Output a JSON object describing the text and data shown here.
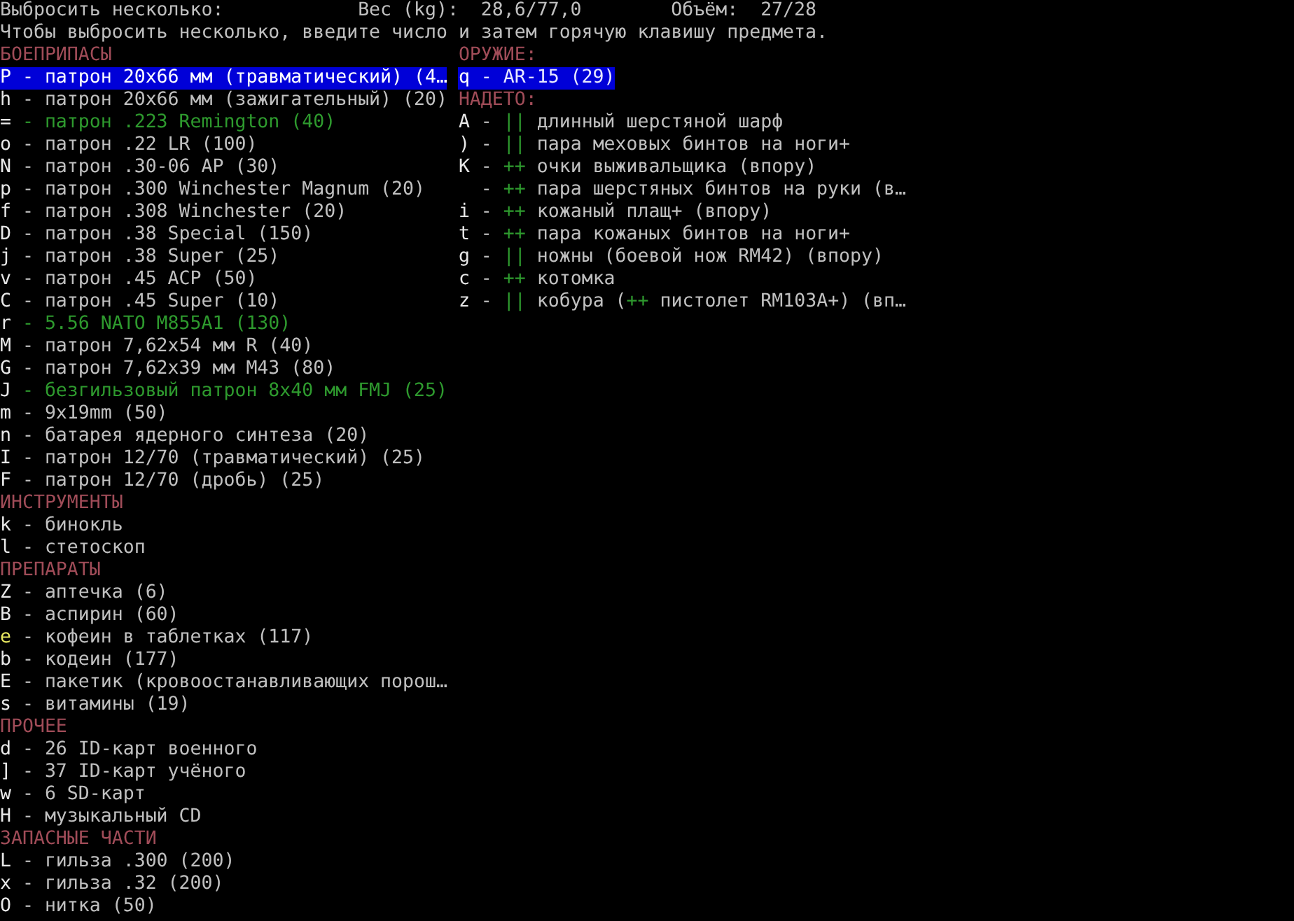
{
  "header": {
    "title": "Выбросить несколько:",
    "weight_label": "Вес (kg):",
    "weight_value": "28,6/77,0",
    "volume_label": "Объём:",
    "volume_value": "27/28"
  },
  "instructions": "Чтобы выбросить несколько, введите число и затем горячую клавишу предмета.",
  "left_sections": [
    {
      "title": "БОЕПРИПАСЫ",
      "items": [
        {
          "key": "P",
          "label": "- патрон 20x66 мм (травматический) (4…",
          "kind": "plain",
          "key_highlighted": false,
          "selected": true
        },
        {
          "key": "h",
          "label": "- патрон 20x66 мм (зажигательный) (20)",
          "kind": "plain",
          "key_highlighted": false,
          "selected": false
        },
        {
          "key": "=",
          "label": "- патрон .223 Remington (40)",
          "kind": "marked",
          "key_highlighted": false,
          "selected": false
        },
        {
          "key": "o",
          "label": "- патрон .22 LR (100)",
          "kind": "plain",
          "key_highlighted": false,
          "selected": false
        },
        {
          "key": "N",
          "label": "- патрон .30-06 AP (30)",
          "kind": "plain",
          "key_highlighted": false,
          "selected": false
        },
        {
          "key": "p",
          "label": "- патрон .300 Winchester Magnum (20)",
          "kind": "plain",
          "key_highlighted": false,
          "selected": false
        },
        {
          "key": "f",
          "label": "- патрон .308 Winchester (20)",
          "kind": "plain",
          "key_highlighted": false,
          "selected": false
        },
        {
          "key": "D",
          "label": "- патрон .38 Special (150)",
          "kind": "plain",
          "key_highlighted": false,
          "selected": false
        },
        {
          "key": "j",
          "label": "- патрон .38 Super (25)",
          "kind": "plain",
          "key_highlighted": false,
          "selected": false
        },
        {
          "key": "v",
          "label": "- патрон .45 ACP (50)",
          "kind": "plain",
          "key_highlighted": false,
          "selected": false
        },
        {
          "key": "C",
          "label": "- патрон .45 Super (10)",
          "kind": "plain",
          "key_highlighted": false,
          "selected": false
        },
        {
          "key": "r",
          "label": "- 5.56 NATO M855A1 (130)",
          "kind": "marked",
          "key_highlighted": false,
          "selected": false
        },
        {
          "key": "M",
          "label": "- патрон 7,62x54 мм R (40)",
          "kind": "plain",
          "key_highlighted": false,
          "selected": false
        },
        {
          "key": "G",
          "label": "- патрон 7,62x39 мм M43 (80)",
          "kind": "plain",
          "key_highlighted": false,
          "selected": false
        },
        {
          "key": "J",
          "label": "- безгильзовый патрон 8x40 мм FMJ (25)",
          "kind": "marked",
          "key_highlighted": false,
          "selected": false
        },
        {
          "key": "m",
          "label": "- 9x19mm (50)",
          "kind": "plain",
          "key_highlighted": false,
          "selected": false
        },
        {
          "key": "n",
          "label": "- батарея ядерного синтеза (20)",
          "kind": "plain",
          "key_highlighted": false,
          "selected": false
        },
        {
          "key": "I",
          "label": "- патрон 12/70 (травматический) (25)",
          "kind": "plain",
          "key_highlighted": false,
          "selected": false
        },
        {
          "key": "F",
          "label": "- патрон 12/70 (дробь) (25)",
          "kind": "plain",
          "key_highlighted": false,
          "selected": false
        }
      ]
    },
    {
      "title": "ИНСТРУМЕНТЫ",
      "items": [
        {
          "key": "k",
          "label": "- бинокль",
          "kind": "plain",
          "key_highlighted": false,
          "selected": false
        },
        {
          "key": "l",
          "label": "- стетоскоп",
          "kind": "plain",
          "key_highlighted": false,
          "selected": false
        }
      ]
    },
    {
      "title": "ПРЕПАРАТЫ",
      "items": [
        {
          "key": "Z",
          "label": "- аптечка (6)",
          "kind": "plain",
          "key_highlighted": false,
          "selected": false
        },
        {
          "key": "B",
          "label": "- аспирин (60)",
          "kind": "plain",
          "key_highlighted": false,
          "selected": false
        },
        {
          "key": "e",
          "label": "- кофеин в таблетках (117)",
          "kind": "plain",
          "key_highlighted": true,
          "selected": false
        },
        {
          "key": "b",
          "label": "- кодеин (177)",
          "kind": "plain",
          "key_highlighted": false,
          "selected": false
        },
        {
          "key": "E",
          "label": "- пакетик (кровоостанавливающих порош…",
          "kind": "plain",
          "key_highlighted": false,
          "selected": false
        },
        {
          "key": "s",
          "label": "- витамины (19)",
          "kind": "plain",
          "key_highlighted": false,
          "selected": false
        }
      ]
    },
    {
      "title": "ПРОЧЕЕ",
      "items": [
        {
          "key": "d",
          "label": "- 26 ID-карт военного",
          "kind": "plain",
          "key_highlighted": false,
          "selected": false
        },
        {
          "key": "]",
          "label": "- 37 ID-карт учёного",
          "kind": "plain",
          "key_highlighted": false,
          "selected": false
        },
        {
          "key": "w",
          "label": "- 6 SD-карт",
          "kind": "plain",
          "key_highlighted": false,
          "selected": false
        },
        {
          "key": "H",
          "label": "- музыкальный CD",
          "kind": "plain",
          "key_highlighted": false,
          "selected": false
        }
      ]
    },
    {
      "title": "ЗАПАСНЫЕ ЧАСТИ",
      "items": [
        {
          "key": "L",
          "label": "- гильза .300 (200)",
          "kind": "plain",
          "key_highlighted": false,
          "selected": false
        },
        {
          "key": "x",
          "label": "- гильза .32 (200)",
          "kind": "plain",
          "key_highlighted": false,
          "selected": false
        },
        {
          "key": "O",
          "label": "- нитка (50)",
          "kind": "plain",
          "key_highlighted": false,
          "selected": false
        }
      ]
    }
  ],
  "weapon": {
    "title": "ОРУЖИЕ:",
    "items": [
      {
        "key": "q",
        "label": "- AR-15 (29)",
        "selected": true
      }
    ]
  },
  "worn": {
    "title": "НАДЕТО:",
    "items": [
      {
        "key": "A",
        "parts": [
          {
            "text": "-",
            "kind": "plain"
          },
          {
            "text": "||",
            "kind": "marker"
          },
          {
            "text": "длинный шерстяной шарф",
            "kind": "plain"
          }
        ]
      },
      {
        "key": ")",
        "parts": [
          {
            "text": "-",
            "kind": "plain"
          },
          {
            "text": "||",
            "kind": "marker"
          },
          {
            "text": "пара меховых бинтов на ноги+",
            "kind": "plain"
          }
        ]
      },
      {
        "key": "K",
        "parts": [
          {
            "text": "-",
            "kind": "plain"
          },
          {
            "text": "++",
            "kind": "marker"
          },
          {
            "text": "очки выживальщика (впору)",
            "kind": "plain"
          }
        ]
      },
      {
        "parts": [
          {
            "text": "-",
            "kind": "plain"
          },
          {
            "text": "++",
            "kind": "marker"
          },
          {
            "text": "пара шерстяных бинтов на руки (в…",
            "kind": "plain"
          }
        ]
      },
      {
        "key": "i",
        "parts": [
          {
            "text": "-",
            "kind": "plain"
          },
          {
            "text": "++",
            "kind": "marker"
          },
          {
            "text": "кожаный плащ+ (впору)",
            "kind": "plain"
          }
        ]
      },
      {
        "key": "t",
        "parts": [
          {
            "text": "-",
            "kind": "plain"
          },
          {
            "text": "++",
            "kind": "marker"
          },
          {
            "text": "пара кожаных бинтов на ноги+",
            "kind": "plain"
          }
        ]
      },
      {
        "key": "g",
        "parts": [
          {
            "text": "-",
            "kind": "plain"
          },
          {
            "text": "||",
            "kind": "marker"
          },
          {
            "text": "ножны (боевой нож RM42) (впору)",
            "kind": "plain"
          }
        ]
      },
      {
        "key": "c",
        "parts": [
          {
            "text": "-",
            "kind": "plain"
          },
          {
            "text": "++",
            "kind": "marker"
          },
          {
            "text": "котомка",
            "kind": "plain"
          }
        ]
      },
      {
        "key": "z",
        "parts": [
          {
            "text": "-",
            "kind": "plain"
          },
          {
            "text": "||",
            "kind": "marker"
          },
          {
            "text": "кобура (",
            "kind": "plain"
          },
          {
            "text": "++",
            "kind": "marker"
          },
          {
            "text": "пистолет RM103A+) (вп…",
            "kind": "plain"
          }
        ]
      }
    ]
  }
}
